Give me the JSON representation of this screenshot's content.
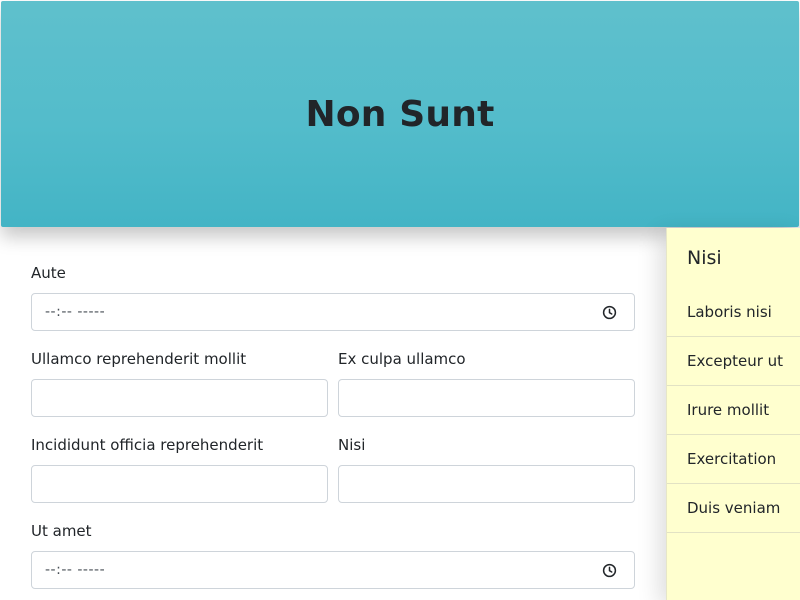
{
  "header": {
    "title": "Non Sunt"
  },
  "form": {
    "field_1": {
      "label": "Aute",
      "value": "--:-- -----"
    },
    "field_2": {
      "label": "Ullamco reprehenderit mollit",
      "value": ""
    },
    "field_3": {
      "label": "Ex culpa ullamco",
      "value": ""
    },
    "field_4": {
      "label": "Incididunt officia reprehenderit",
      "value": ""
    },
    "field_5": {
      "label": "Nisi",
      "value": ""
    },
    "field_6": {
      "label": "Ut amet",
      "value": "--:-- -----"
    }
  },
  "sidebar": {
    "heading": "Nisi",
    "items": [
      {
        "label": "Laboris nisi"
      },
      {
        "label": "Excepteur ut"
      },
      {
        "label": "Irure mollit"
      },
      {
        "label": "Exercitation"
      },
      {
        "label": "Duis veniam"
      }
    ]
  },
  "icons": {
    "time_field_icon": "clock-icon"
  },
  "colors": {
    "header_gradient_top": "#5fc0cc",
    "header_gradient_bottom": "#43b4c5",
    "sidebar_background": "#ffffcf",
    "input_border": "#ced4da",
    "text": "#212529"
  }
}
